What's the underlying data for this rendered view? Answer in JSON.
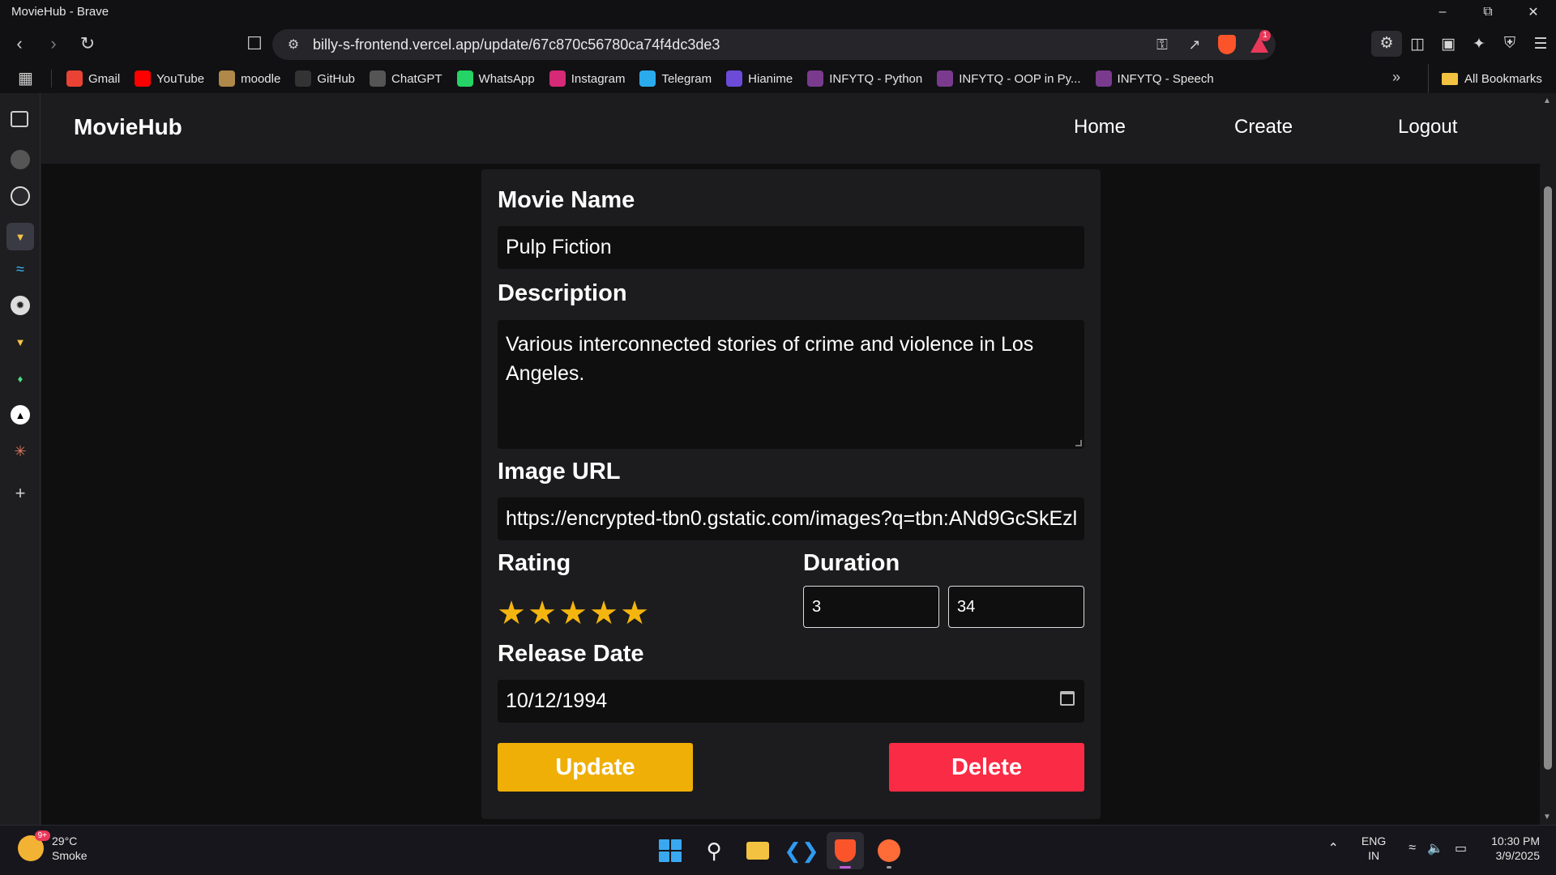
{
  "window": {
    "title": "MovieHub - Brave"
  },
  "browser": {
    "url": "billy-s-frontend.vercel.app/update/67c870c56780ca74f4dc3de3",
    "rewards_badge": "1"
  },
  "bookmarks": {
    "items": [
      {
        "label": "Gmail",
        "icon": "gmail-icon",
        "color": "#ea4335"
      },
      {
        "label": "YouTube",
        "icon": "youtube-icon",
        "color": "#ff0000"
      },
      {
        "label": "moodle",
        "icon": "moodle-icon",
        "color": "#b0884a"
      },
      {
        "label": "GitHub",
        "icon": "github-icon",
        "color": "#333333"
      },
      {
        "label": "ChatGPT",
        "icon": "chatgpt-icon",
        "color": "#555555"
      },
      {
        "label": "WhatsApp",
        "icon": "whatsapp-icon",
        "color": "#25d366"
      },
      {
        "label": "Instagram",
        "icon": "instagram-icon",
        "color": "#d62976"
      },
      {
        "label": "Telegram",
        "icon": "telegram-icon",
        "color": "#2aabee"
      },
      {
        "label": "Hianime",
        "icon": "hianime-icon",
        "color": "#6b4bd8"
      },
      {
        "label": "INFYTQ - Python",
        "icon": "infytq-icon",
        "color": "#7a3b8f"
      },
      {
        "label": "INFYTQ - OOP in Py...",
        "icon": "infytq-icon",
        "color": "#7a3b8f"
      },
      {
        "label": "INFYTQ - Speech",
        "icon": "infytq-icon",
        "color": "#7a3b8f"
      }
    ],
    "all_label": "All Bookmarks"
  },
  "app": {
    "brand": "MovieHub",
    "nav": {
      "home": "Home",
      "create": "Create",
      "logout": "Logout"
    }
  },
  "form": {
    "movie_name_label": "Movie Name",
    "movie_name_value": "Pulp Fiction",
    "description_label": "Description",
    "description_value": "Various interconnected stories of crime and violence in Los Angeles.",
    "image_url_label": "Image URL",
    "image_url_value": "https://encrypted-tbn0.gstatic.com/images?q=tbn:ANd9GcSkEzl",
    "rating_label": "Rating",
    "rating_value": 5,
    "rating_max": 5,
    "star_glyph": "★",
    "duration_label": "Duration",
    "duration_hours": "3",
    "duration_minutes": "34",
    "release_date_label": "Release Date",
    "release_date_value": "10/12/1994",
    "update_label": "Update",
    "delete_label": "Delete"
  },
  "colors": {
    "update": "#efaf06",
    "delete": "#fa2b45",
    "star": "#f5b50f"
  },
  "taskbar": {
    "temperature": "29°C",
    "weather": "Smoke",
    "weather_badge": "9+",
    "lang_top": "ENG",
    "lang_bottom": "IN",
    "time": "10:30 PM",
    "date": "3/9/2025"
  }
}
